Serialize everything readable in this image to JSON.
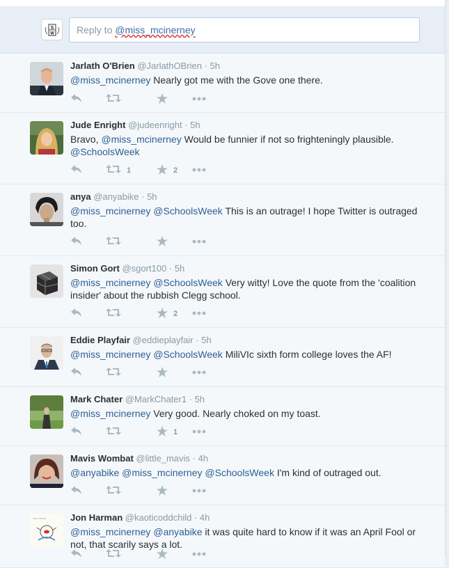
{
  "reply": {
    "prefix": "Reply to ",
    "handle": "@miss_mcinerney",
    "avatar_text": "SW"
  },
  "tweets": [
    {
      "name": "Jarlath O'Brien",
      "screen": "@JarlathOBrien",
      "time": "5h",
      "parts": [
        {
          "t": "@miss_mcinerney",
          "m": true
        },
        {
          "t": " Nearly got me with the Gove one there."
        }
      ],
      "retweets": "",
      "favorites": "",
      "avatar": "jarlath"
    },
    {
      "name": "Jude Enright",
      "screen": "@judeenright",
      "time": "5h",
      "parts": [
        {
          "t": "Bravo, "
        },
        {
          "t": "@miss_mcinerney",
          "m": true
        },
        {
          "t": " Would be funnier if not so frighteningly plausible. "
        },
        {
          "t": "@SchoolsWeek",
          "m": true
        }
      ],
      "retweets": "1",
      "favorites": "2",
      "avatar": "jude"
    },
    {
      "name": "anya",
      "screen": "@anyabike",
      "time": "5h",
      "parts": [
        {
          "t": "@miss_mcinerney",
          "m": true
        },
        {
          "t": " "
        },
        {
          "t": "@SchoolsWeek",
          "m": true
        },
        {
          "t": " This is an outrage! I hope Twitter is outraged too."
        }
      ],
      "retweets": "",
      "favorites": "",
      "avatar": "anya"
    },
    {
      "name": "Simon Gort",
      "screen": "@sgort100",
      "time": "5h",
      "parts": [
        {
          "t": "@miss_mcinerney",
          "m": true
        },
        {
          "t": " "
        },
        {
          "t": "@SchoolsWeek",
          "m": true
        },
        {
          "t": " Very witty! Love the quote from the 'coalition insider' about the rubbish Clegg school."
        }
      ],
      "retweets": "",
      "favorites": "2",
      "avatar": "simon"
    },
    {
      "name": "Eddie Playfair",
      "screen": "@eddieplayfair",
      "time": "5h",
      "parts": [
        {
          "t": "@miss_mcinerney",
          "m": true
        },
        {
          "t": " "
        },
        {
          "t": "@SchoolsWeek",
          "m": true
        },
        {
          "t": " MiliVIc sixth form college loves the AF!"
        }
      ],
      "retweets": "",
      "favorites": "",
      "avatar": "eddie"
    },
    {
      "name": "Mark Chater",
      "screen": "@MarkChater1",
      "time": "5h",
      "parts": [
        {
          "t": "@miss_mcinerney",
          "m": true
        },
        {
          "t": " Very good. Nearly choked on my toast."
        }
      ],
      "retweets": "",
      "favorites": "1",
      "avatar": "mark"
    },
    {
      "name": "Mavis Wombat",
      "screen": "@little_mavis",
      "time": "4h",
      "parts": [
        {
          "t": "@anyabike",
          "m": true
        },
        {
          "t": " "
        },
        {
          "t": "@miss_mcinerney",
          "m": true
        },
        {
          "t": " "
        },
        {
          "t": "@SchoolsWeek",
          "m": true
        },
        {
          "t": " I'm kind of outraged out."
        }
      ],
      "retweets": "",
      "favorites": "",
      "avatar": "mavis"
    },
    {
      "name": "Jon Harman",
      "screen": "@kaoticoddchild",
      "time": "4h",
      "parts": [
        {
          "t": "@miss_mcinerney",
          "m": true
        },
        {
          "t": " "
        },
        {
          "t": "@anyabike",
          "m": true
        },
        {
          "t": " it was quite hard to know if it was an April Fool or not, that scarily says a lot."
        }
      ],
      "retweets": "",
      "favorites": "",
      "avatar": "jon"
    }
  ],
  "icons": {
    "reply": "reply-icon",
    "retweet": "retweet-icon",
    "favorite": "star-icon",
    "more": "more-icon"
  },
  "colors": {
    "mention": "#2b5f96",
    "name": "#292f33",
    "muted": "#8899a6",
    "icon": "#aab8c2"
  }
}
